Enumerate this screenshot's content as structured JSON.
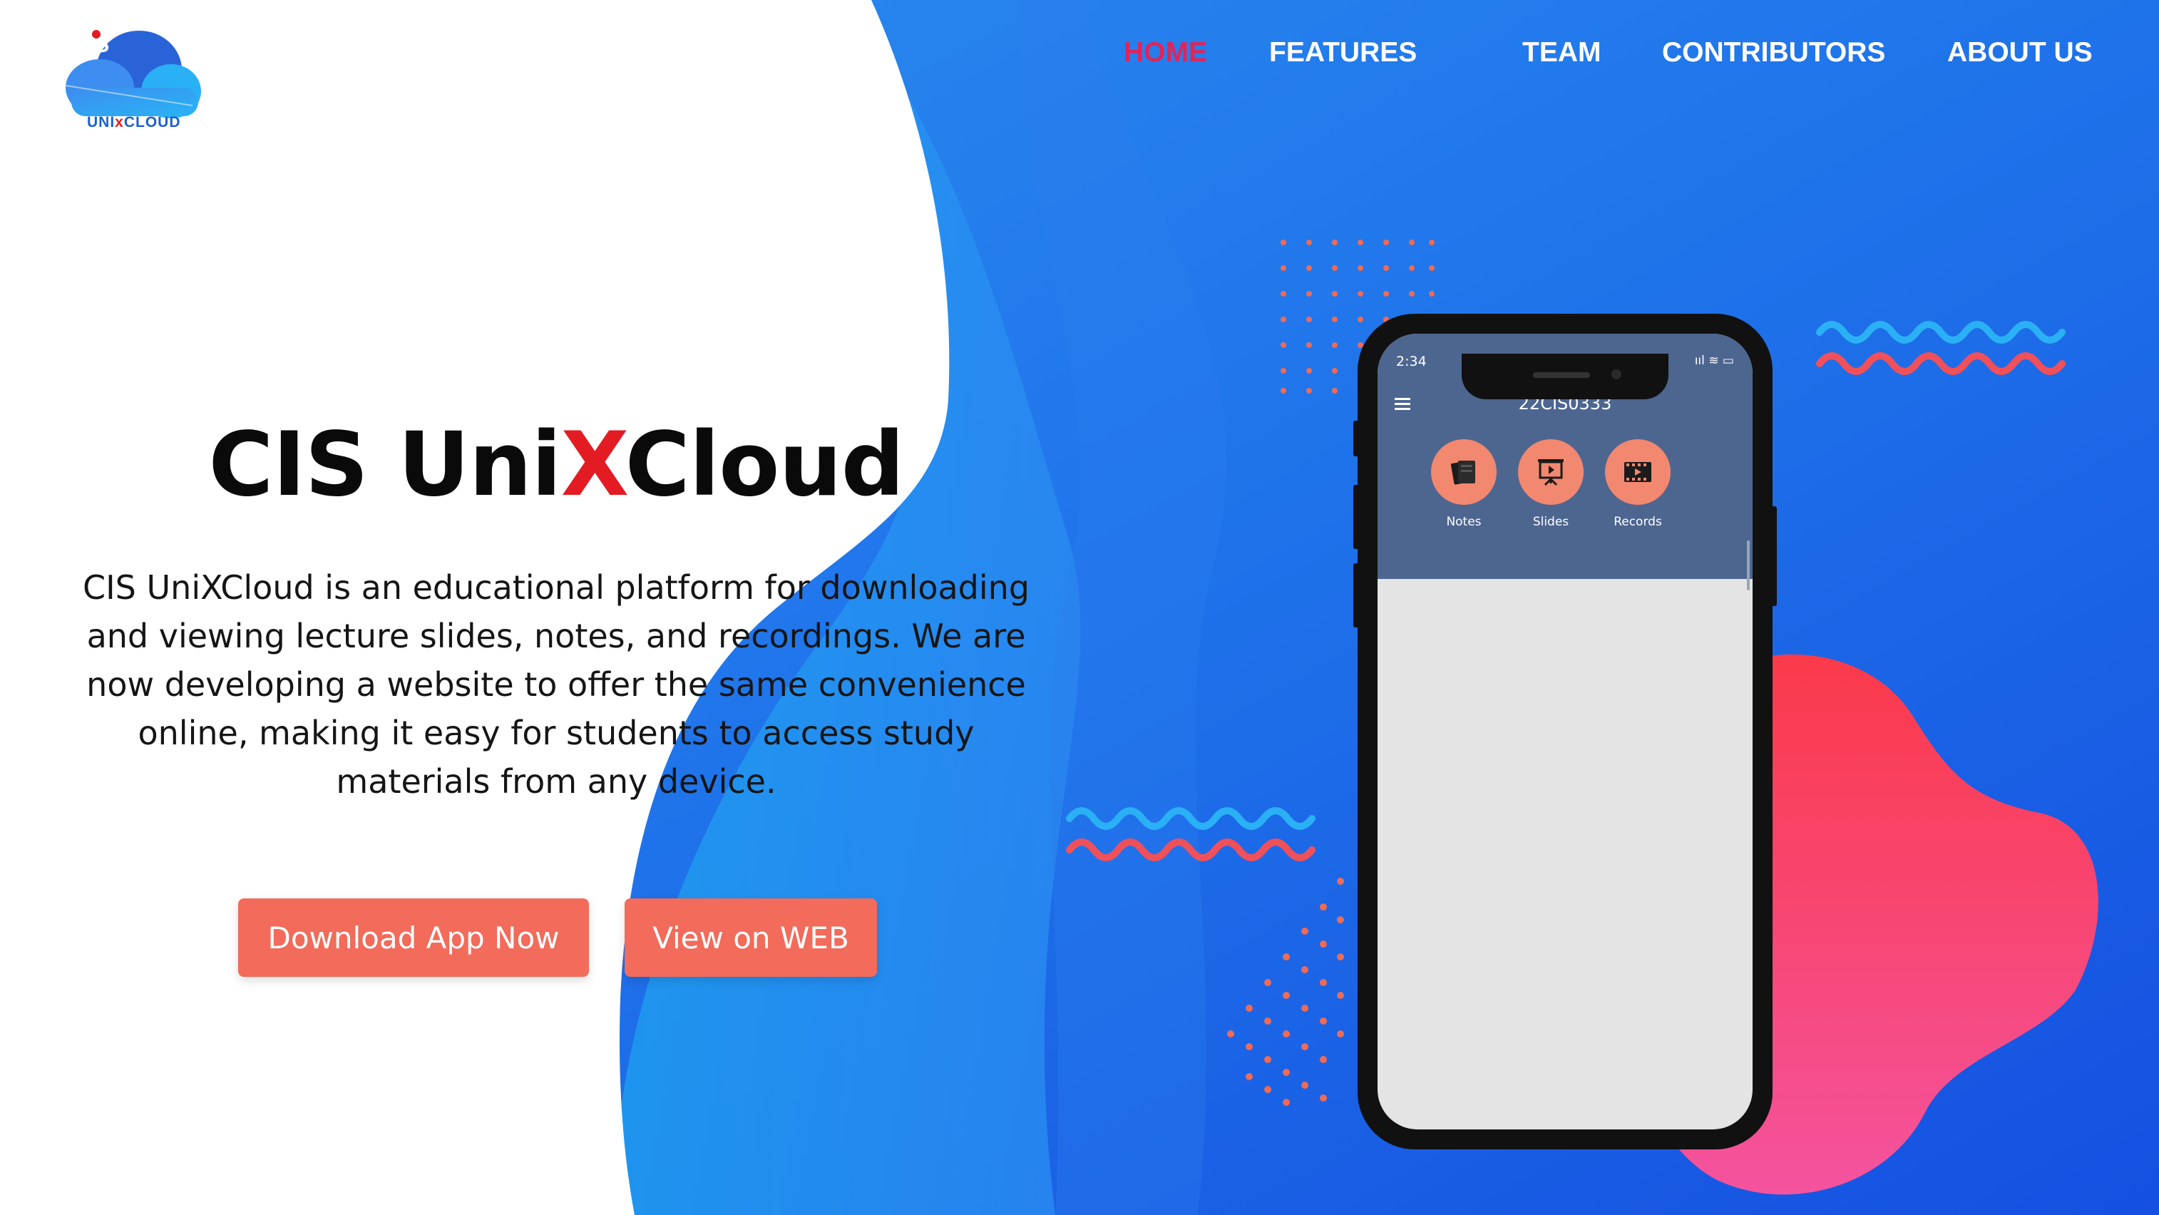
{
  "brand": {
    "logo_text_pre": "UNI",
    "logo_text_x": "x",
    "logo_text_post": "CLOUD",
    "logo_icon": "cloud-logo-icon"
  },
  "nav": {
    "items": [
      {
        "label": "HOME",
        "active": true
      },
      {
        "label": "FEATURES",
        "active": false
      },
      {
        "label": "TEAM",
        "active": false
      },
      {
        "label": "CONTRIBUTORS",
        "active": false
      },
      {
        "label": "ABOUT US",
        "active": false
      }
    ]
  },
  "hero": {
    "title_pre": "CIS Uni",
    "title_x": "X",
    "title_post": "Cloud",
    "description": "CIS UniXCloud is an educational platform for downloading and viewing lecture slides, notes, and recordings. We are now developing a website to offer the same convenience online, making it easy for students to access study materials from any device.",
    "download_button": "Download App Now",
    "web_button": "View on WEB"
  },
  "phone": {
    "status_time": "2:34",
    "status_icons": "ııl ≋ ▭",
    "app_title": "22CIS0333",
    "buttons": [
      {
        "label": "Notes",
        "icon": "notes-icon"
      },
      {
        "label": "Slides",
        "icon": "slides-icon"
      },
      {
        "label": "Records",
        "icon": "records-icon"
      }
    ]
  },
  "colors": {
    "accent": "#f26b5b",
    "active_nav": "#e0245a",
    "brand_blue": "#1b5fd0",
    "x_red": "#e31b23",
    "app_header": "#4d6690"
  }
}
